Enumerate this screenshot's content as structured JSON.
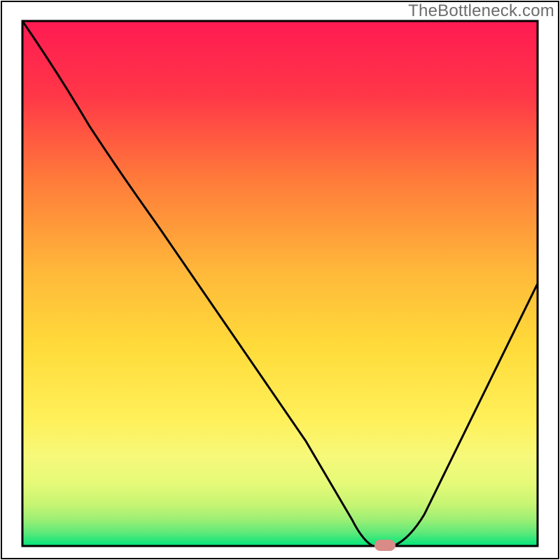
{
  "watermark": "TheBottleneck.com",
  "chart_data": {
    "type": "line",
    "title": "",
    "xlabel": "",
    "ylabel": "",
    "xlim": [
      0,
      100
    ],
    "ylim": [
      0,
      100
    ],
    "series": [
      {
        "name": "bottleneck-curve",
        "x": [
          0,
          13,
          27,
          41,
          55,
          64,
          68,
          72,
          78,
          100
        ],
        "values": [
          100,
          80,
          60,
          40,
          20,
          5,
          0,
          0,
          6,
          50
        ]
      }
    ],
    "marker": {
      "name": "optimal-point",
      "x": 70,
      "y": 0,
      "color": "#d98b88"
    },
    "background_gradient": {
      "top": "#ff1a52",
      "mid_upper": "#ff8b3a",
      "mid": "#ffd93a",
      "mid_lower": "#f7f97a",
      "lower": "#b8f56f",
      "bottom": "#00e57a"
    },
    "frame": {
      "outer_margin": 2,
      "inner_margin_top": 30,
      "inner_margin_side": 32,
      "inner_margin_bottom": 20
    }
  }
}
